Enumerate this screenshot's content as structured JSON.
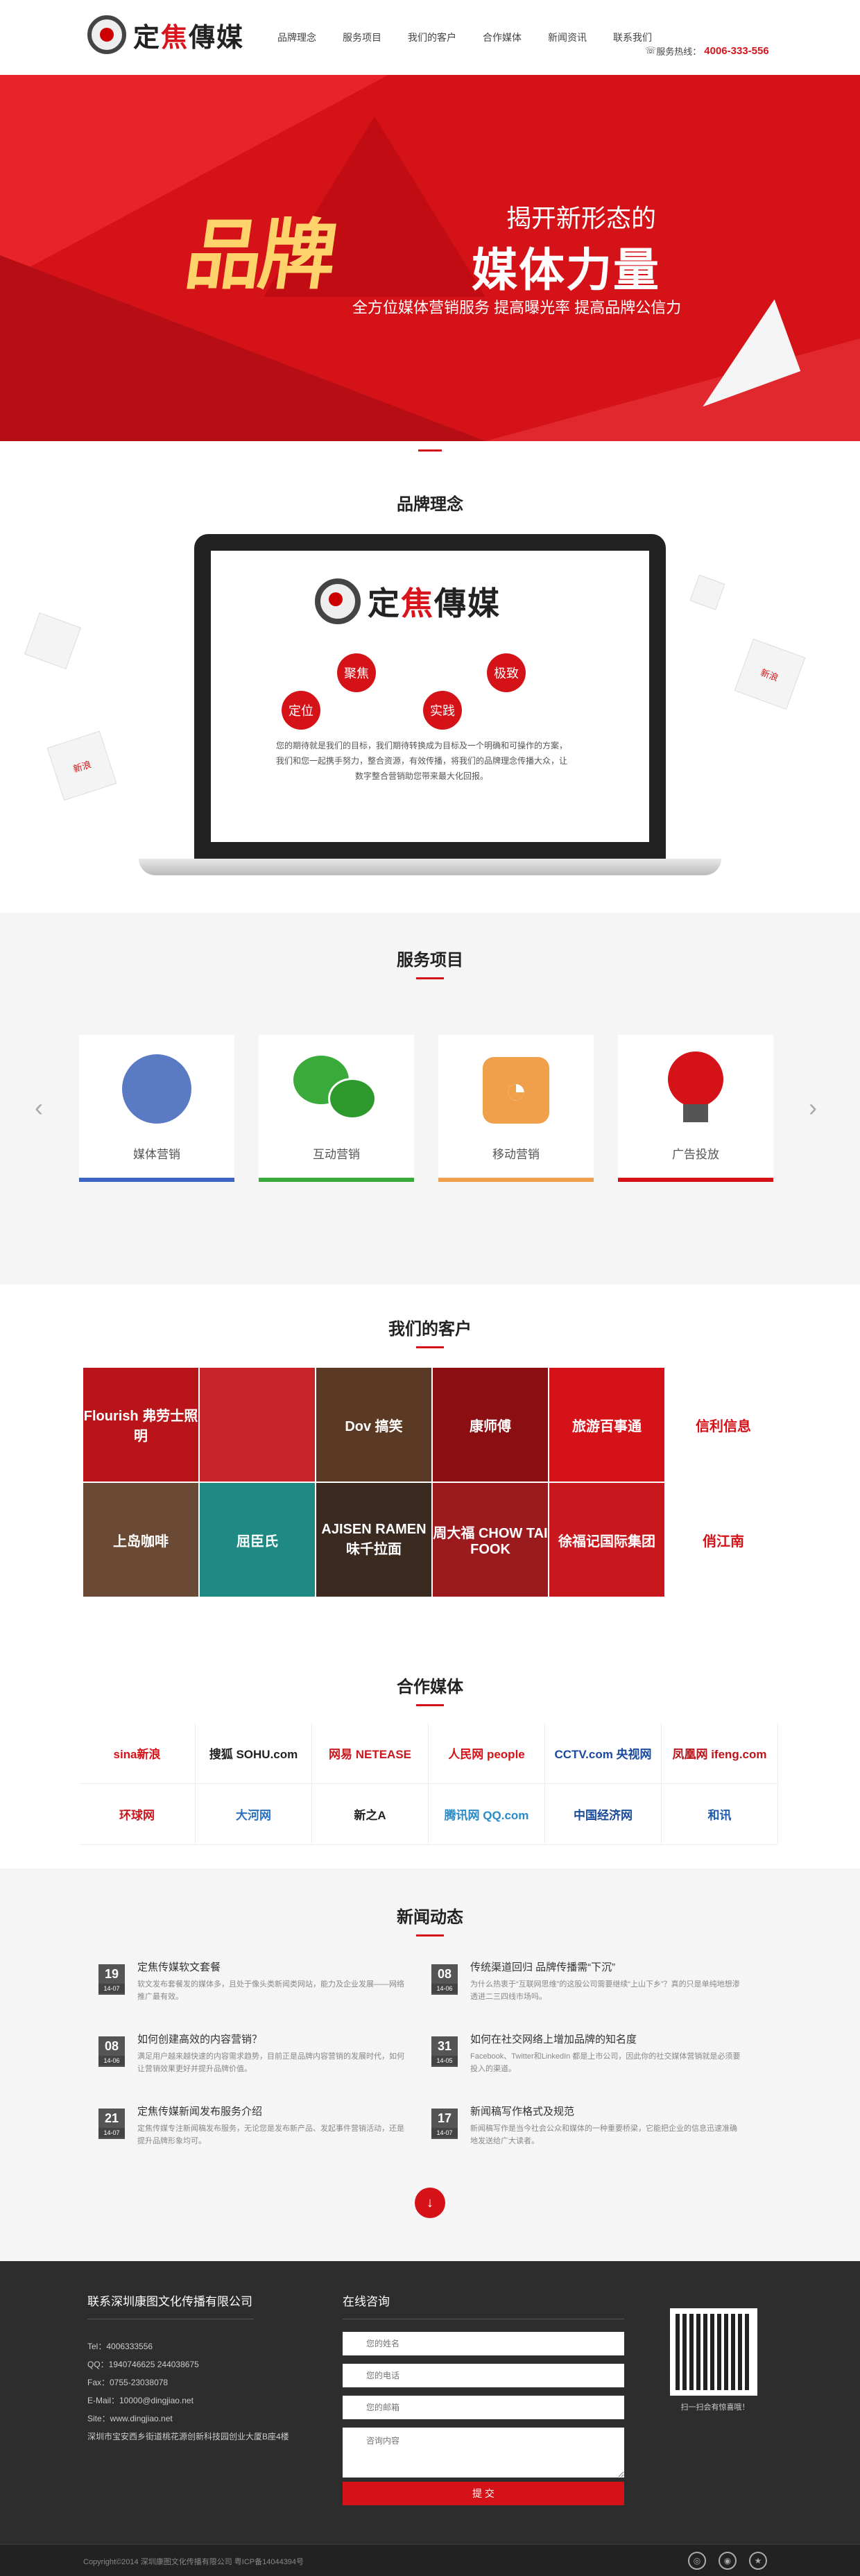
{
  "header": {
    "logo_text_1": "定",
    "logo_text_2": "焦",
    "logo_text_3": "傳媒",
    "nav": [
      "品牌理念",
      "服务项目",
      "我们的客户",
      "合作媒体",
      "新闻资讯",
      "联系我们"
    ],
    "hotline_label": "服务热线：",
    "hotline_number": "4006-333-556"
  },
  "banner": {
    "big_text": "品牌",
    "line1": "揭开新形态的",
    "line2": "媒体力量",
    "line3": "全方位媒体营销服务  提高曝光率  提高品牌公信力"
  },
  "brand": {
    "title": "品牌理念",
    "logo_text_1": "定",
    "logo_text_2": "焦",
    "logo_text_3": "傳媒",
    "circles": [
      "聚焦",
      "极致",
      "定位",
      "实践"
    ],
    "text": "您的期待就是我们的目标，我们期待转换成为目标及一个明确和可操作的方案，我们和您一起携手努力，整合资源，有效传播，将我们的品牌理念传播大众，让数字整合营销助您带来最大化回报。",
    "cube_text": "新浪"
  },
  "services": {
    "title": "服务项目",
    "items": [
      {
        "label": "媒体营销",
        "color": "#3b64c4",
        "icon": "globe-icon"
      },
      {
        "label": "互动营销",
        "color": "#3aab3a",
        "icon": "wechat-icon"
      },
      {
        "label": "移动营销",
        "color": "#f0a04a",
        "icon": "rss-icon"
      },
      {
        "label": "广告投放",
        "color": "#d41218",
        "icon": "lightbulb-icon"
      }
    ],
    "prev": "‹",
    "next": "›"
  },
  "clients": {
    "title": "我们的客户",
    "items": [
      {
        "label": "Flourish 弗劳士照明",
        "bg": "#b8141a"
      },
      {
        "label": "",
        "bg": "#c8252a"
      },
      {
        "label": "Dov 搞笑",
        "bg": "#5a3a24"
      },
      {
        "label": "康师傅",
        "bg": "#8a0e12"
      },
      {
        "label": "旅游百事通",
        "bg": "#d41218"
      },
      {
        "label": "信利信息",
        "bg": "#ffffff"
      },
      {
        "label": "上岛咖啡",
        "bg": "#6a4a34"
      },
      {
        "label": "屈臣氏",
        "bg": "#1f8a84"
      },
      {
        "label": "AJISEN RAMEN 味千拉面",
        "bg": "#3a2a20"
      },
      {
        "label": "周大福 CHOW TAI FOOK",
        "bg": "#9a1a1e"
      },
      {
        "label": "徐福记国际集团",
        "bg": "#c8181e"
      },
      {
        "label": "俏江南",
        "bg": "#ffffff"
      }
    ]
  },
  "media": {
    "title": "合作媒体",
    "items": [
      {
        "label": "sina新浪",
        "color": "#d41218"
      },
      {
        "label": "搜狐 SOHU.com",
        "color": "#222222"
      },
      {
        "label": "网易 NETEASE",
        "color": "#c8181e"
      },
      {
        "label": "人民网 people",
        "color": "#d41218"
      },
      {
        "label": "CCTV.com 央视网",
        "color": "#1a4aa0"
      },
      {
        "label": "凤凰网 ifeng.com",
        "color": "#b8141a"
      },
      {
        "label": "环球网",
        "color": "#c8181e"
      },
      {
        "label": "大河网",
        "color": "#2a70c0"
      },
      {
        "label": "新之A",
        "color": "#222222"
      },
      {
        "label": "腾讯网 QQ.com",
        "color": "#2a8ac8"
      },
      {
        "label": "中国经济网",
        "color": "#1a4a9a"
      },
      {
        "label": "和讯",
        "color": "#1a5ab0"
      }
    ]
  },
  "news": {
    "title": "新闻动态",
    "items": [
      {
        "day": "19",
        "month": "14-07",
        "title": "定焦传媒软文套餐",
        "desc": "软文发布套餐发的媒体多，且处于像头类新闻类网站，能力及企业发展——网络推广最有效。"
      },
      {
        "day": "08",
        "month": "14-06",
        "title": "传统渠道回归 品牌传播需“下沉”",
        "desc": "为什么热衷于“互联网思维”的这股公司需要继续“上山下乡”？真的只是单纯地想渗透进二三四线市场吗。"
      },
      {
        "day": "08",
        "month": "14-06",
        "title": "如何创建高效的内容营销？",
        "desc": "满足用户越来越快速的内容需求趋势，目前正是品牌内容营销的发展时代，如何让营销效果更好并提升品牌价值。"
      },
      {
        "day": "31",
        "month": "14-05",
        "title": "如何在社交网络上增加品牌的知名度",
        "desc": "Facebook、Twitter和LinkedIn 都是上市公司，因此你的社交媒体营销就是必须要投入的渠道。"
      },
      {
        "day": "21",
        "month": "14-07",
        "title": "定焦传媒新闻发布服务介绍",
        "desc": "定焦传媒专注新闻稿发布服务，无论您是发布新产品、发起事件营销活动，还是提升品牌形象均可。"
      },
      {
        "day": "17",
        "month": "14-07",
        "title": "新闻稿写作格式及规范",
        "desc": "新闻稿写作是当今社会公众和媒体的一种重要桥梁，它能把企业的信息迅速准确地发送给广大读者。"
      }
    ],
    "more": "↓"
  },
  "footer": {
    "company": "联系深圳康图文化传播有限公司",
    "lines": [
      "Tel：4006333556",
      "QQ：1940746625    244038675",
      "Fax：0755-23038078",
      "E-Mail：10000@dingjiao.net",
      "Site：www.dingjiao.net",
      "深圳市宝安西乡街道桃花源创新科技园创业大厦B座4楼"
    ],
    "consult_title": "在线咨询",
    "name_placeholder": "您的姓名",
    "phone_placeholder": "您的电话",
    "email_placeholder": "您的邮箱",
    "content_placeholder": "咨询内容",
    "submit": "提 交",
    "qr_caption": "扫一扫会有惊喜哦！",
    "copyright": "Copyright©2014 深圳康图文化传播有限公司  粤ICP备14044394号"
  }
}
